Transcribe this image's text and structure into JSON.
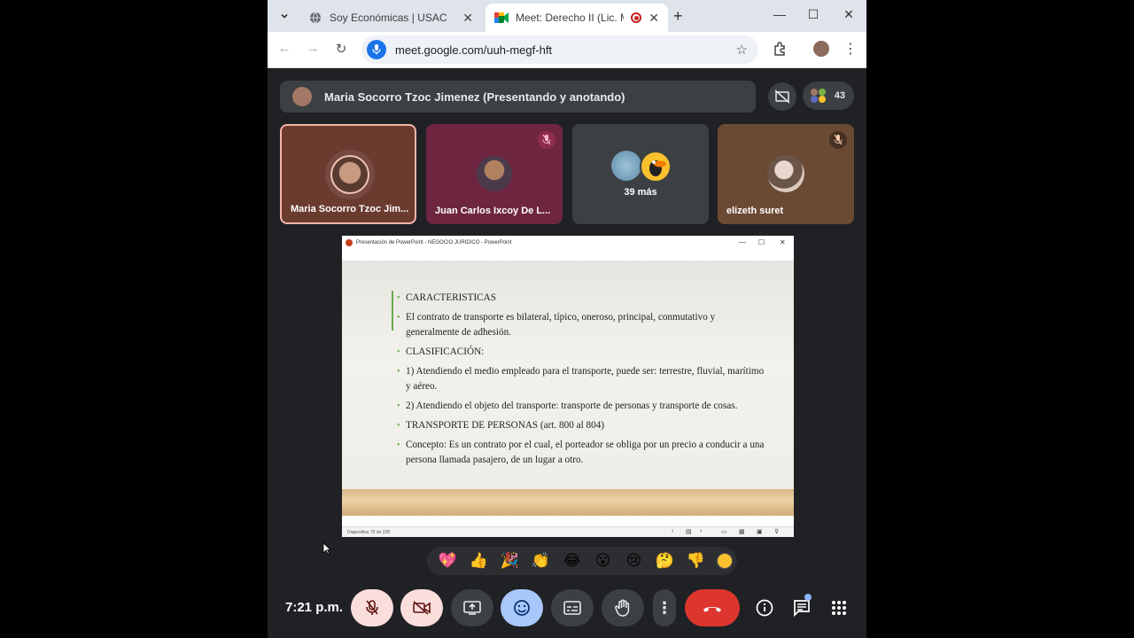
{
  "browser": {
    "tabs": [
      {
        "title": "Soy Económicas | USAC",
        "active": false
      },
      {
        "title": "Meet: Derecho II (Lic. Maria",
        "active": true
      }
    ],
    "url": "meet.google.com/uuh-megf-hft"
  },
  "meet": {
    "presenter_label": "Maria Socorro Tzoc Jimenez (Presentando y anotando)",
    "participant_count": "43",
    "tiles": [
      {
        "name": "Maria Socorro Tzoc Jim...",
        "muted": false
      },
      {
        "name": "Juan Carlos Ixcoy De L...",
        "muted": true
      },
      {
        "name": "39 más",
        "muted": false
      },
      {
        "name": "elizeth suret",
        "muted": true
      }
    ],
    "time": "7:21 p.m."
  },
  "shared_screen": {
    "window_title": "Presentación de PowerPoint  -  NEGOCIO JURIDICO - PowerPoint",
    "slide_bullets": [
      "CARACTERISTICAS",
      "El contrato de transporte es bilateral, típico, oneroso, principal, conmutativo y generalmente de adhesión.",
      "CLASIFICACIÓN:",
      " 1) Atendiendo el medio empleado para el transporte, puede ser: terrestre, fluvial, marítimo y aéreo.",
      "2) Atendiendo el objeto del transporte: transporte de personas y transporte de cosas.",
      "TRANSPORTE DE PERSONAS (art. 800 al 804)",
      "Concepto: Es un contrato por el cual, el porteador se obliga por un precio a conducir a una persona llamada pasajero, de un lugar a otro."
    ],
    "status": "Diapositiva 70 de 228"
  },
  "reactions": [
    "💖",
    "👍",
    "🎉",
    "👏",
    "😂",
    "😮",
    "😢",
    "🤔",
    "👎"
  ],
  "colors": {
    "end_call": "#dc362e",
    "reaction_active": "#a8c7fa",
    "muted_bg": "#f9dedc",
    "accent": "#1a73e8"
  }
}
